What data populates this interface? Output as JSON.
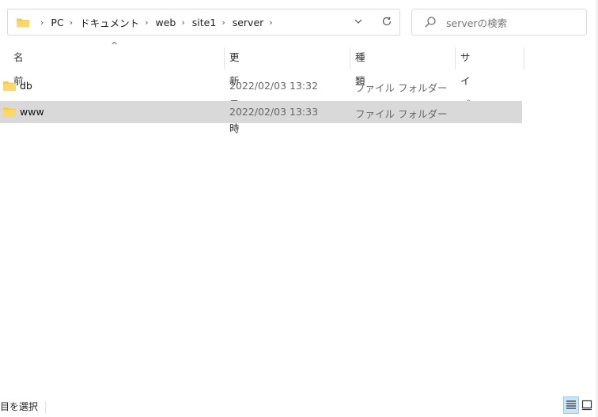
{
  "address_bar": {
    "breadcrumbs": [
      "PC",
      "ドキュメント",
      "web",
      "site1",
      "server"
    ]
  },
  "search": {
    "placeholder": "serverの検索"
  },
  "columns": {
    "name": "名前",
    "date": "更新日時",
    "type": "種類",
    "size": "サイズ"
  },
  "rows": [
    {
      "name": "db",
      "date": "2022/02/03 13:32",
      "type": "ファイル フォルダー",
      "selected": false
    },
    {
      "name": "www",
      "date": "2022/02/03 13:33",
      "type": "ファイル フォルダー",
      "selected": true
    }
  ],
  "status": {
    "text": "目を選択"
  },
  "icons": {
    "folder": "folder-icon",
    "separator": "chevron-right-icon",
    "dropdown": "chevron-down-icon",
    "refresh": "refresh-icon",
    "search": "search-icon",
    "sort": "sort-ascending-icon",
    "details_view": "details-view-icon",
    "preview_view": "large-icons-view-icon"
  },
  "colors": {
    "folder": "#f8c94a",
    "selection": "#d9d9d9",
    "active_view": "#cce4f7"
  }
}
